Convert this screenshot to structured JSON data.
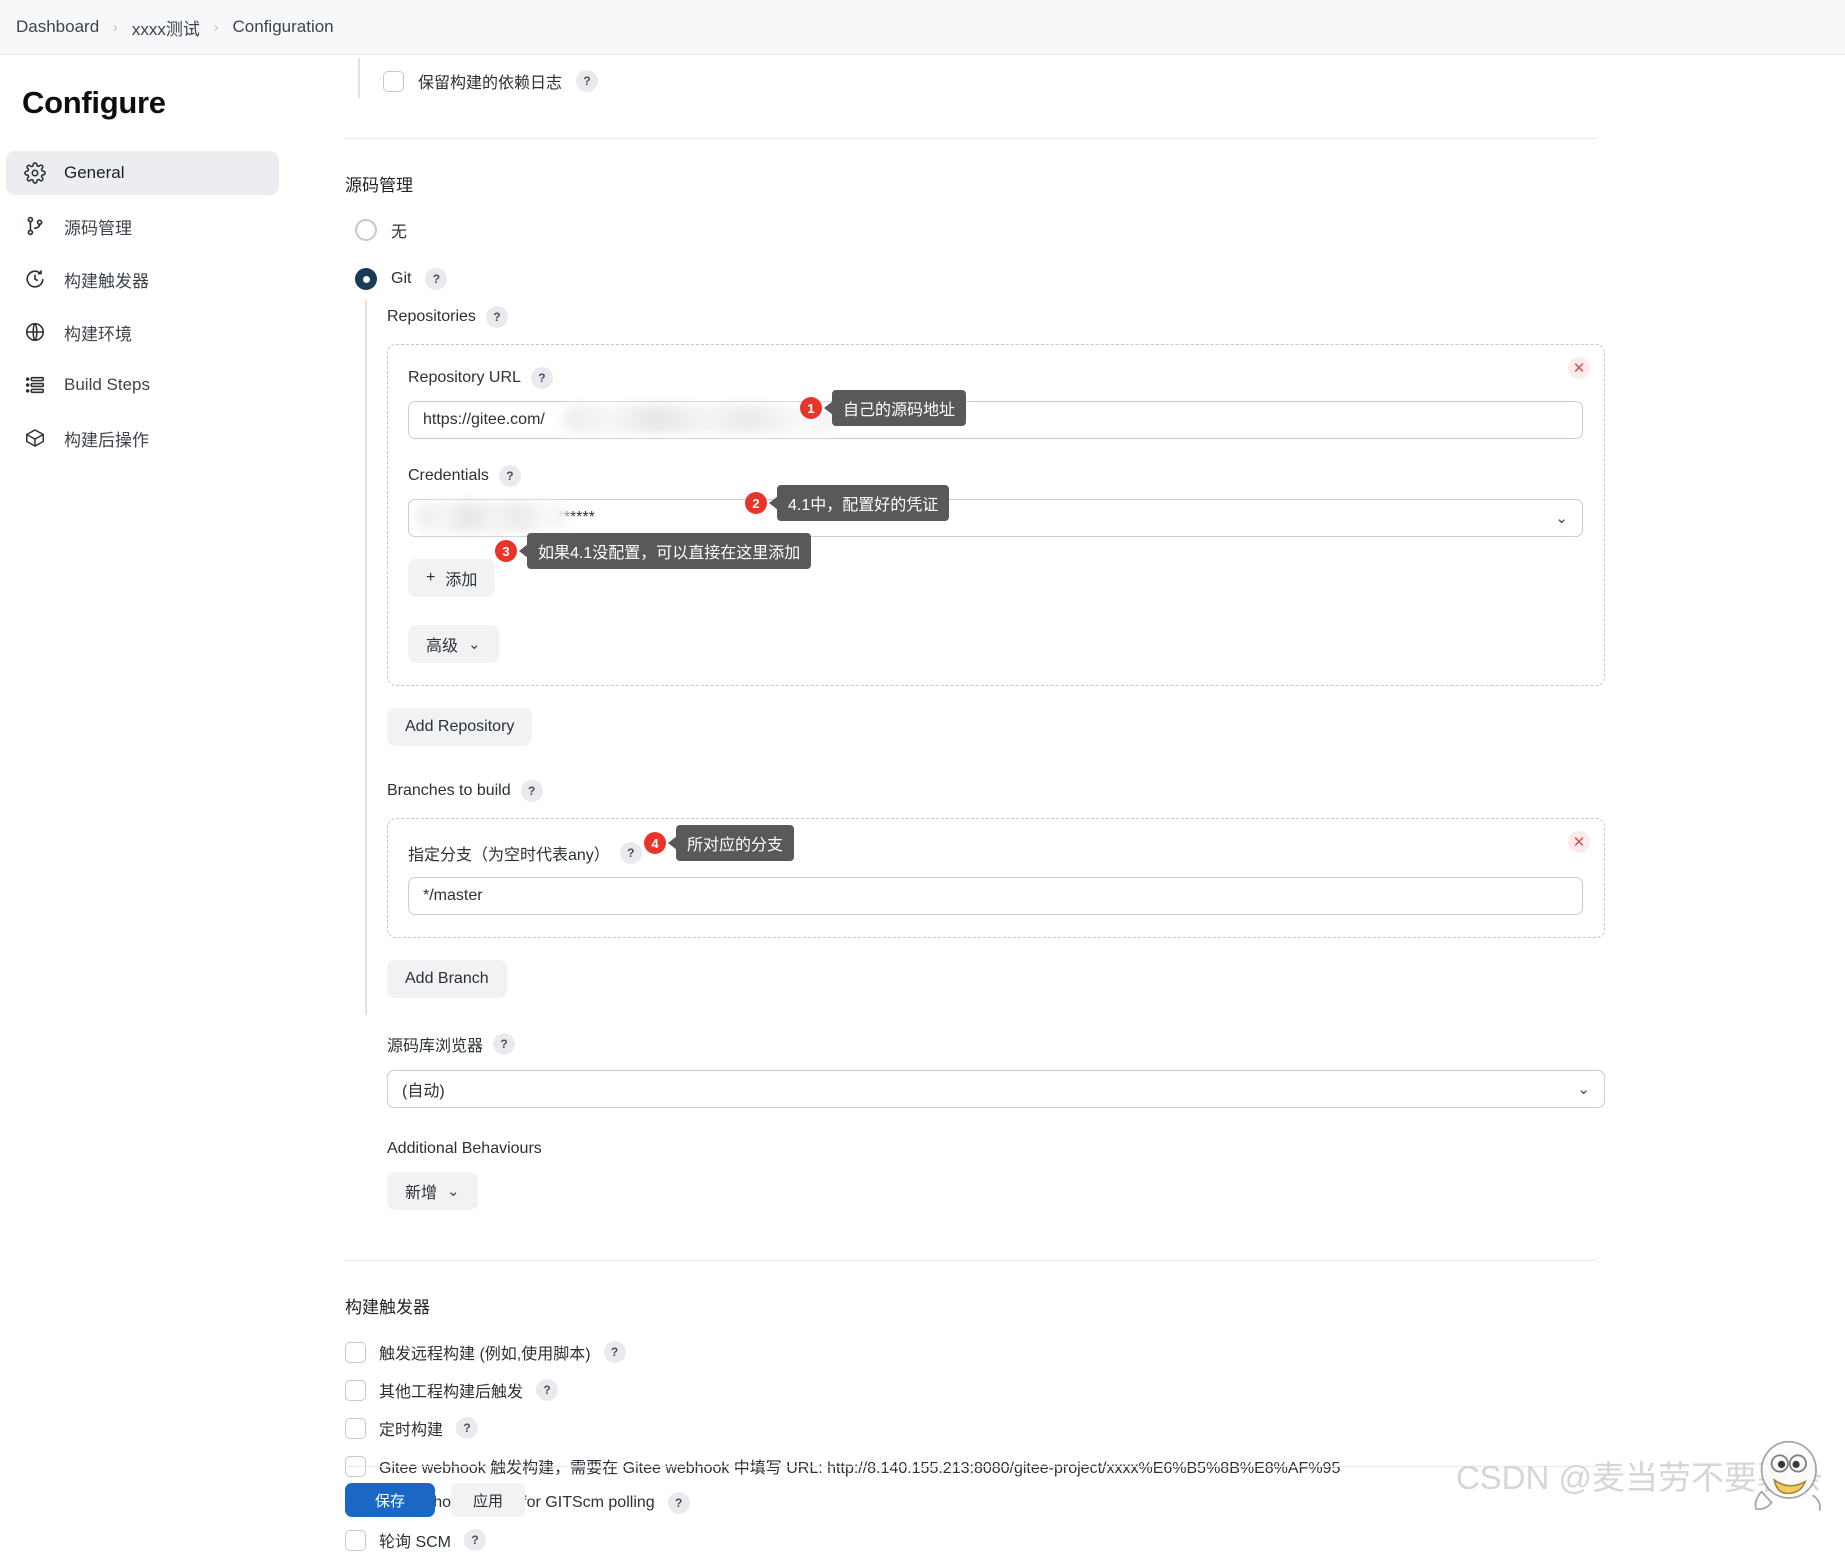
{
  "breadcrumb": {
    "items": [
      "Dashboard",
      "xxxx测试",
      "Configuration"
    ],
    "separator": "›"
  },
  "page_title": "Configure",
  "sidebar": {
    "items": [
      {
        "label": "General",
        "icon": "gear-icon",
        "active": true
      },
      {
        "label": "源码管理",
        "icon": "git-branch-icon",
        "active": false
      },
      {
        "label": "构建触发器",
        "icon": "clock-icon",
        "active": false
      },
      {
        "label": "构建环境",
        "icon": "globe-icon",
        "active": false
      },
      {
        "label": "Build Steps",
        "icon": "list-icon",
        "active": false
      },
      {
        "label": "构建后操作",
        "icon": "package-icon",
        "active": false
      }
    ]
  },
  "general": {
    "keep_dependency_log_label": "保留构建的依赖日志",
    "help_glyph": "?"
  },
  "scm": {
    "section_title": "源码管理",
    "radio_none": "无",
    "radio_git": "Git",
    "repositories_label": "Repositories",
    "repository_url_label": "Repository URL",
    "repository_url_value": "https://gitee.com/",
    "credentials_label": "Credentials",
    "credentials_value": "/******",
    "add_credentials_label": "添加",
    "add_credentials_plus": "+",
    "advanced_label": "高级",
    "add_repository_label": "Add Repository",
    "branches_label": "Branches to build",
    "branch_specifier_label": "指定分支（为空时代表any）",
    "branch_specifier_value": "*/master",
    "add_branch_label": "Add Branch",
    "repo_browser_label": "源码库浏览器",
    "repo_browser_value": "(自动)",
    "additional_behaviours_label": "Additional Behaviours",
    "add_behaviour_label": "新增",
    "remove_glyph": "✕",
    "chevron_glyph": "⌄"
  },
  "callouts": [
    {
      "num": "1",
      "text": "自己的源码地址"
    },
    {
      "num": "2",
      "text": "4.1中，配置好的凭证"
    },
    {
      "num": "3",
      "text": "如果4.1没配置，可以直接在这里添加"
    },
    {
      "num": "4",
      "text": "所对应的分支"
    }
  ],
  "triggers": {
    "section_title": "构建触发器",
    "items": [
      {
        "label": "触发远程构建 (例如,使用脚本)",
        "help": true
      },
      {
        "label": "其他工程构建后触发",
        "help": true
      },
      {
        "label": "定时构建",
        "help": true
      },
      {
        "label": "Gitee webhook 触发构建，需要在 Gitee webhook 中填写 URL: http://8.140.155.213:8080/gitee-project/xxxx%E6%B5%8B%E8%AF%95",
        "help": false
      },
      {
        "label": "GitHub hook trigger for GITScm polling",
        "help": true
      },
      {
        "label": "轮询 SCM",
        "help": true
      }
    ]
  },
  "footer": {
    "save_label": "保存",
    "apply_label": "应用"
  },
  "watermark": {
    "text": "CSDN @麦当劳不要薯条"
  },
  "colors": {
    "accent": "#1b68c4",
    "radio_selected": "#1b3a57",
    "callout_red": "#e8342a",
    "callout_bg": "#59595b"
  }
}
